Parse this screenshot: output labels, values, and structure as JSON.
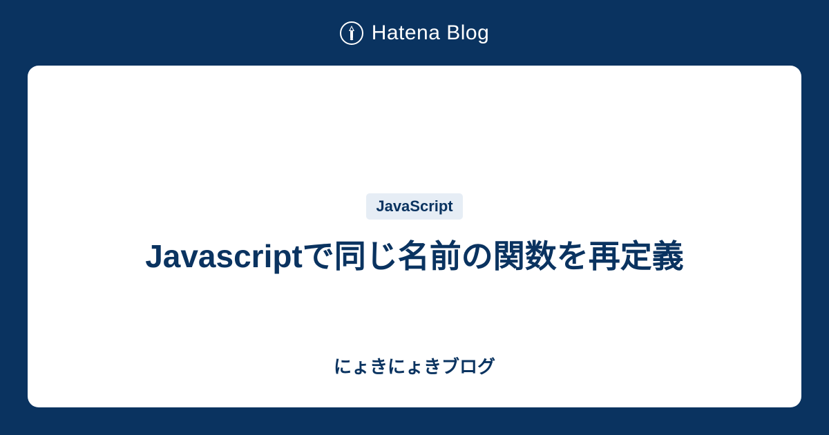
{
  "header": {
    "brand": "Hatena Blog"
  },
  "card": {
    "tag": "JavaScript",
    "title": "Javascriptで同じ名前の関数を再定義",
    "blog_name": "にょきにょきブログ"
  }
}
